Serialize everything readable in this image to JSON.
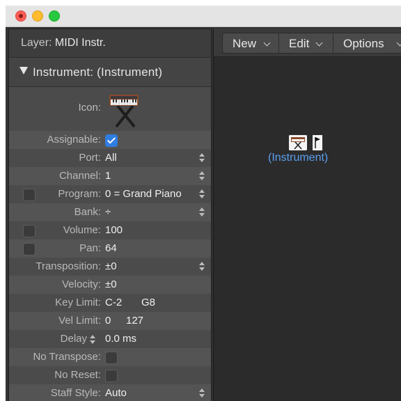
{
  "inspector": {
    "layer_label": "Layer:",
    "layer_value": "MIDI Instr.",
    "instrument_header": "Instrument:  (Instrument)",
    "icon_label": "Icon:",
    "rows": {
      "assignable": {
        "label": "Assignable:",
        "checked": true
      },
      "port": {
        "label": "Port:",
        "value": "All"
      },
      "channel": {
        "label": "Channel:",
        "value": "1"
      },
      "program": {
        "label": "Program:",
        "value": "0 = Grand Piano"
      },
      "bank": {
        "label": "Bank:",
        "value": "÷"
      },
      "volume": {
        "label": "Volume:",
        "value": "100"
      },
      "pan": {
        "label": "Pan:",
        "value": "64"
      },
      "transposition": {
        "label": "Transposition:",
        "value": "±0"
      },
      "velocity": {
        "label": "Velocity:",
        "value": "±0"
      },
      "key_limit": {
        "label": "Key Limit:",
        "low": "C-2",
        "high": "G8"
      },
      "vel_limit": {
        "label": "Vel Limit:",
        "low": "0",
        "high": "127"
      },
      "delay": {
        "label": "Delay",
        "value": "0.0 ms"
      },
      "no_transpose": {
        "label": "No Transpose:"
      },
      "no_reset": {
        "label": "No Reset:"
      },
      "staff_style": {
        "label": "Staff Style:",
        "value": "Auto"
      }
    }
  },
  "toolbar": {
    "menus": [
      "New",
      "Edit",
      "Options"
    ]
  },
  "canvas": {
    "object_name": "(Instrument)"
  },
  "icons": {
    "instrument": "keyboard-on-stand-icon",
    "flag": "flag-icon"
  },
  "colors": {
    "accent": "#2f7de1",
    "object_name": "#5b9ff0",
    "traffic_red": "#fe5f57",
    "traffic_yellow": "#febc2e",
    "traffic_green": "#28c840"
  }
}
